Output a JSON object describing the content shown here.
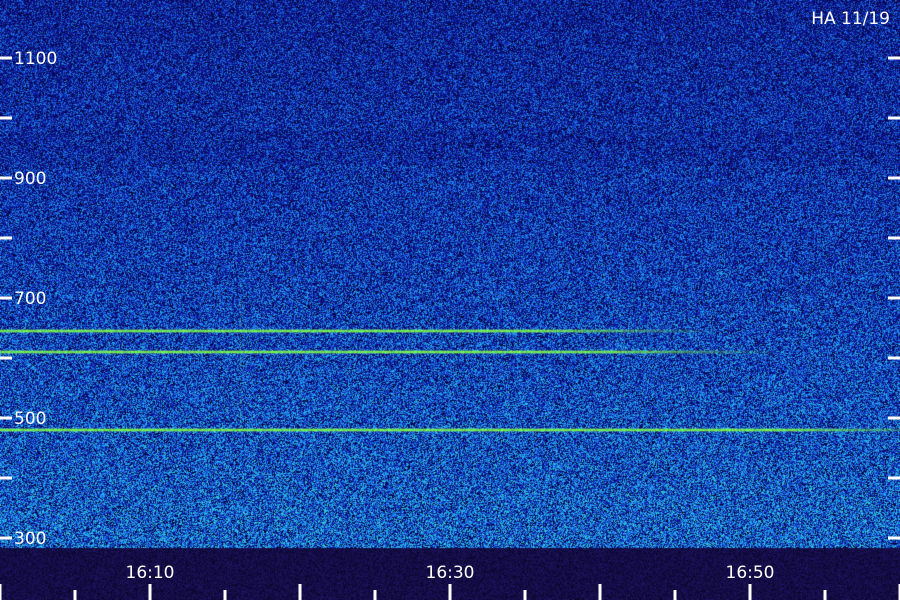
{
  "plot_label": "HA 11/19",
  "colors": {
    "background": "#0b0b6e",
    "band": "#7cff3c",
    "text": "#ffffff"
  },
  "chart_data": {
    "type": "heatmap",
    "title": "",
    "xlabel": "",
    "ylabel": "",
    "x_tick_labels": [
      "16:10",
      "16:30",
      "16:50"
    ],
    "x_tick_values_minutes": [
      10,
      30,
      50
    ],
    "xlim_minutes": [
      0,
      60
    ],
    "y_tick_labels": [
      "1100",
      "900",
      "700",
      "500",
      "300"
    ],
    "y_tick_values": [
      1100,
      900,
      700,
      500,
      300
    ],
    "ylim": [
      300,
      1100
    ],
    "horizontal_lines": [
      {
        "y": 645,
        "x_end_minutes": 36
      },
      {
        "y": 610,
        "x_end_minutes": 40
      },
      {
        "y": 480,
        "x_end_minutes": 52
      }
    ]
  }
}
